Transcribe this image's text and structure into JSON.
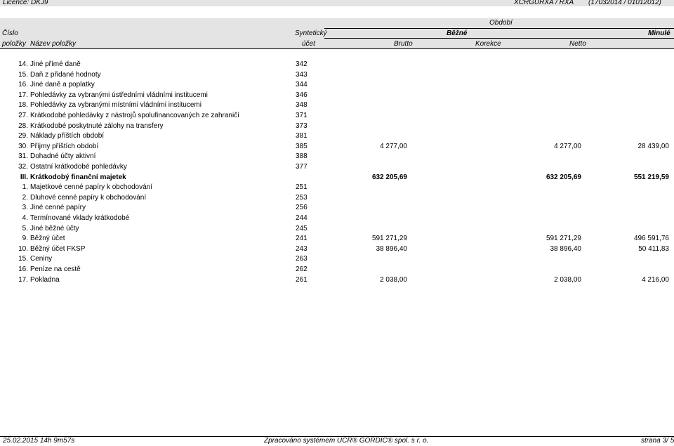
{
  "header": {
    "licence": "Licence: DKJ9",
    "report_code": "XCRGURXA / RXA",
    "report_id": "(17032014 / 01012012)"
  },
  "columns": {
    "cislo": "Číslo",
    "polozky": "položky",
    "nazev": "Název položky",
    "synteticky": "Syntetický",
    "ucet": "účet",
    "obdobi": "Období",
    "bezne": "Běžné",
    "minule": "Minulé",
    "brutto": "Brutto",
    "korekce": "Korekce",
    "netto": "Netto"
  },
  "rows": [
    {
      "num": "14.",
      "name": "Jiné přímé daně",
      "acct": "342",
      "v1": "",
      "v3": "",
      "v4": ""
    },
    {
      "num": "15.",
      "name": "Daň z přidané hodnoty",
      "acct": "343",
      "v1": "",
      "v3": "",
      "v4": ""
    },
    {
      "num": "16.",
      "name": "Jiné daně a poplatky",
      "acct": "344",
      "v1": "",
      "v3": "",
      "v4": ""
    },
    {
      "num": "17.",
      "name": "Pohledávky za vybranými ústředními vládními institucemi",
      "acct": "346",
      "v1": "",
      "v3": "",
      "v4": ""
    },
    {
      "num": "18.",
      "name": "Pohledávky za vybranými místními vládními institucemi",
      "acct": "348",
      "v1": "",
      "v3": "",
      "v4": ""
    },
    {
      "num": "27.",
      "name": "Krátkodobé pohledávky z nástrojů spolufinancovaných ze zahraničí",
      "acct": "371",
      "v1": "",
      "v3": "",
      "v4": ""
    },
    {
      "num": "28.",
      "name": "Krátkodobé poskytnuté zálohy na transfery",
      "acct": "373",
      "v1": "",
      "v3": "",
      "v4": ""
    },
    {
      "num": "29.",
      "name": "Náklady příštích období",
      "acct": "381",
      "v1": "",
      "v3": "",
      "v4": ""
    },
    {
      "num": "30.",
      "name": "Příjmy příštích období",
      "acct": "385",
      "v1": "4 277,00",
      "v3": "4 277,00",
      "v4": "28 439,00"
    },
    {
      "num": "31.",
      "name": "Dohadné účty aktivní",
      "acct": "388",
      "v1": "",
      "v3": "",
      "v4": ""
    },
    {
      "num": "32.",
      "name": "Ostatní krátkodobé pohledávky",
      "acct": "377",
      "v1": "",
      "v3": "",
      "v4": ""
    },
    {
      "num": "III.",
      "name": "Krátkodobý finanční majetek",
      "acct": "",
      "v1": "632 205,69",
      "v3": "632 205,69",
      "v4": "551 219,59",
      "bold": true
    },
    {
      "num": "1.",
      "name": "Majetkové cenné papíry k obchodování",
      "acct": "251",
      "v1": "",
      "v3": "",
      "v4": ""
    },
    {
      "num": "2.",
      "name": "Dluhové cenné papíry k obchodování",
      "acct": "253",
      "v1": "",
      "v3": "",
      "v4": ""
    },
    {
      "num": "3.",
      "name": "Jiné cenné papíry",
      "acct": "256",
      "v1": "",
      "v3": "",
      "v4": ""
    },
    {
      "num": "4.",
      "name": "Termínované vklady krátkodobé",
      "acct": "244",
      "v1": "",
      "v3": "",
      "v4": ""
    },
    {
      "num": "5.",
      "name": "Jiné běžné účty",
      "acct": "245",
      "v1": "",
      "v3": "",
      "v4": ""
    },
    {
      "num": "9.",
      "name": "Běžný účet",
      "acct": "241",
      "v1": "591 271,29",
      "v3": "591 271,29",
      "v4": "496 591,76"
    },
    {
      "num": "10.",
      "name": "Běžný účet FKSP",
      "acct": "243",
      "v1": "38 896,40",
      "v3": "38 896,40",
      "v4": "50 411,83"
    },
    {
      "num": "15.",
      "name": "Ceniny",
      "acct": "263",
      "v1": "",
      "v3": "",
      "v4": ""
    },
    {
      "num": "16.",
      "name": "Peníze na cestě",
      "acct": "262",
      "v1": "",
      "v3": "",
      "v4": ""
    },
    {
      "num": "17.",
      "name": "Pokladna",
      "acct": "261",
      "v1": "2 038,00",
      "v3": "2 038,00",
      "v4": "4 216,00"
    }
  ],
  "footer": {
    "datetime": "25.02.2015 14h 9m57s",
    "processed": "Zpracováno systémem   UCR® GORDIC® spol.  s   r. o.",
    "page": "strana  3/ 5"
  }
}
